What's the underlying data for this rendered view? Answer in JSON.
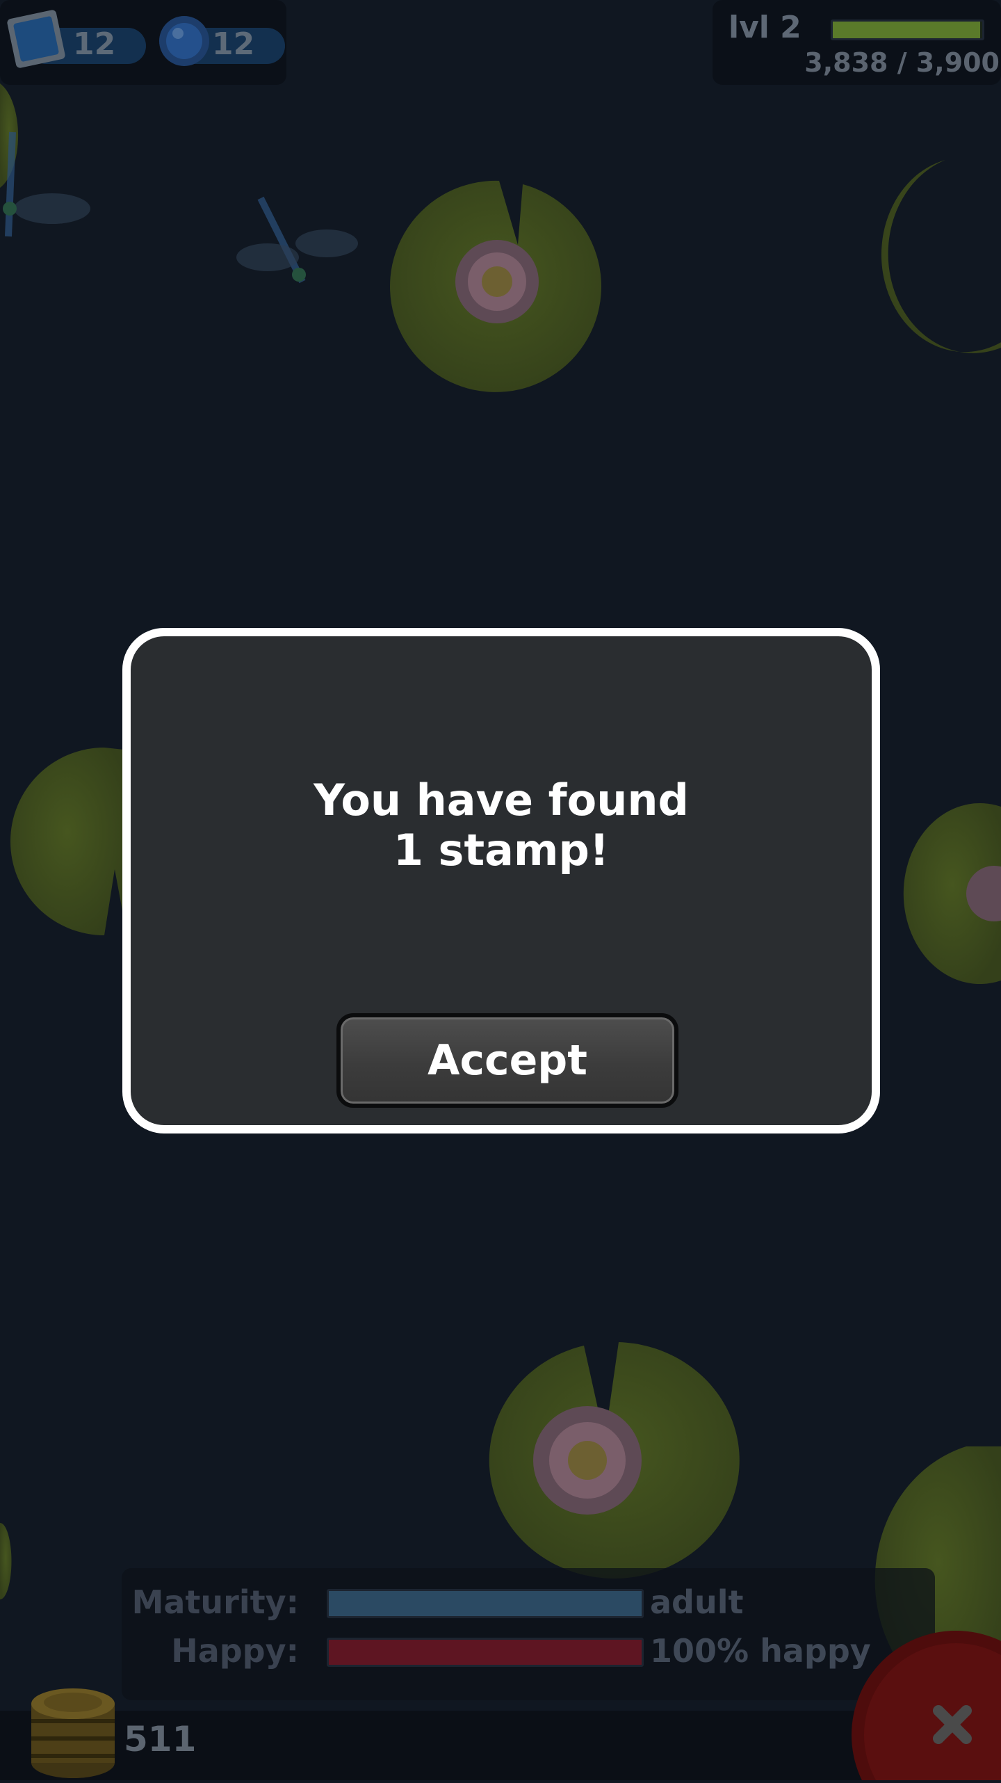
{
  "hud": {
    "stamps_count": "12",
    "gems_count": "12",
    "level_label": "lvl 2",
    "xp_text": "3,838 / 3,900",
    "xp_fraction": 0.984
  },
  "status": {
    "maturity_label": "Maturity:",
    "maturity_value": "adult",
    "maturity_fraction": 1.0,
    "happy_label": "Happy:",
    "happy_value": "100% happy",
    "happy_fraction": 1.0
  },
  "coins": {
    "count": "511"
  },
  "modal": {
    "message_line1": "You have found",
    "message_line2": "1 stamp!",
    "accept_label": "Accept"
  },
  "colors": {
    "water": "#101721",
    "lilypad": "#3c4a1a",
    "lotus": "#6e5560",
    "xp_bar": "#5a7a2a",
    "maturity_bar": "#2b4a63",
    "happy_bar": "#5e1522",
    "close_button": "#5a0d0d"
  },
  "icons": [
    "stamp-icon",
    "gem-icon",
    "coin-stack-icon",
    "close-icon"
  ]
}
